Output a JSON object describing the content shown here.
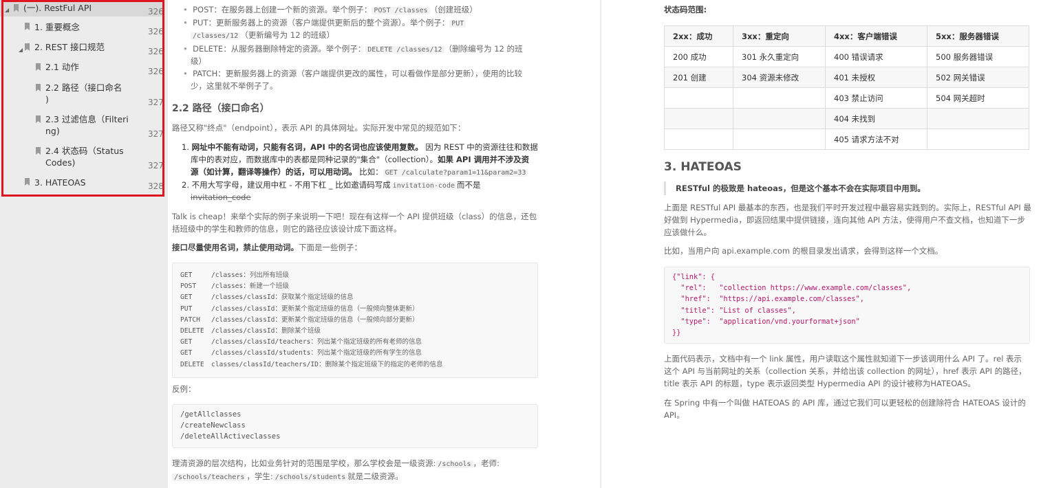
{
  "outline": {
    "items": [
      {
        "label": "(一). RestFul API",
        "page": "326",
        "collapse": "◢"
      },
      {
        "label": "1. 重要概念",
        "page": "326"
      },
      {
        "label": "2. REST 接口规范",
        "page": "326",
        "collapse": "◢"
      },
      {
        "label": "2.1 动作",
        "page": "326"
      },
      {
        "label": "2.2 路径（接口命名",
        "label2": ")",
        "page": "327"
      },
      {
        "label": "2.3 过滤信息（Filteri",
        "label2": "ng)",
        "page": "327"
      },
      {
        "label": "2.4 状态码（Status",
        "label2": "Codes)",
        "page": "327"
      },
      {
        "label": "3. HATEOAS",
        "page": "328"
      }
    ]
  },
  "left": {
    "bullets": {
      "post": {
        "verb": "POST：",
        "text": "在服务器上创建一个新的资源。举个例子：",
        "code": "POST /classes",
        "tail": "（创建班级）"
      },
      "put": {
        "verb": "PUT：",
        "text": "更新服务器上的资源（客户端提供更新后的整个资源）。举个例子：",
        "code1": "PUT",
        "code2": "/classes/12",
        "tail": "（更新编号为 12 的班级）"
      },
      "delete": {
        "verb": "DELETE：",
        "text": "从服务器删除特定的资源。举个例子：",
        "code": "DELETE /classes/12",
        "tail": "（删除编号为 12 的班",
        "tail2": "级）"
      },
      "patch": {
        "verb": "PATCH：",
        "text": "更新服务器上的资源（客户端提供更改的属性，可以看做作是部分更新），使用的比较",
        "text2": "少，这里就不举例子了。"
      }
    },
    "h_path": "2.2 路径（接口命名）",
    "path_intro": "路径又称\"终点\"（endpoint），表示 API 的具体网址。实际开发中常见的规范如下：",
    "rule1": {
      "num": "1.",
      "b1": "网址中不能有动词，只能有名词，API 中的名词也应该使用复数。",
      "t1": "因为 REST 中的资源往往和数据",
      "t2": "库中的表对应，而数据库中的表都是同种记录的\"集合\"（collection）。",
      "b2": "如果 API 调用并不涉及资",
      "b3": "源（如计算，翻译等操作）的话，可以用动词。",
      "t3": "比如：",
      "code": "GET /calculate?param1=11&param2=33"
    },
    "rule2": {
      "num": "2.",
      "t1": "不用大写字母，建议用中杠 - 不用下杠 _ 比如邀请码写成",
      "code": "invitation-code",
      "t2": "而不是",
      "strike": "invitation_code"
    },
    "talk": "Talk is cheap！来举个实际的例子来说明一下吧！现在有这样一个 API 提供班级（class）的信息，还包",
    "talk2": "括班级中的学生和教师的信息，则它的路径应该设计成下面这样。",
    "noun_bold": "接口尽量使用名词，禁止使用动词。",
    "noun_tail": "下面是一些例子：",
    "examples": [
      {
        "m": "GET",
        "p": "/classes：",
        "c": "列出所有班级"
      },
      {
        "m": "POST",
        "p": "/classes：",
        "c": "新建一个班级"
      },
      {
        "m": "GET",
        "p": "/classes/classId：",
        "c": "获取某个指定班级的信息"
      },
      {
        "m": "PUT",
        "p": "/classes/classId：",
        "c": "更新某个指定班级的信息（一般倾向整体更新）"
      },
      {
        "m": "PATCH",
        "p": "/classes/classId：",
        "c": "更新某个指定班级的信息（一般倾向部分更新）"
      },
      {
        "m": "DELETE",
        "p": "/classes/classId：",
        "c": "删除某个班级"
      },
      {
        "m": "GET",
        "p": "/classes/classId/teachers：",
        "c": "列出某个指定班级的所有老师的信息"
      },
      {
        "m": "GET",
        "p": "/classes/classId/students：",
        "c": "列出某个指定班级的所有学生的信息"
      },
      {
        "m": "DELETE",
        "p": "classes/classId/teachers/ID：",
        "c": "删除某个指定班级下的指定的老师的信息"
      }
    ],
    "counter": "反例：",
    "counter_lines": [
      "/getAllclasses",
      "/createNewclass",
      "/deleteAllActiveclasses"
    ],
    "hier1": "理清资源的层次结构，比如业务针对的范围是学校，那么学校会是一级资源:",
    "hier_code1": "/schools",
    "hier_t2": "，老师:",
    "hier_code2": "/schools/teachers",
    "hier_t3": "，学生:",
    "hier_code3": "/schools/students",
    "hier_t4": "就是二级资源。"
  },
  "right": {
    "status_title": "状态码范围:",
    "table": {
      "headers": [
        "2xx：成功",
        "3xx：重定向",
        "4xx：客户端错误",
        "5xx：服务器错误"
      ],
      "rows": [
        [
          "200 成功",
          "301 永久重定向",
          "400 错误请求",
          "500 服务器错误"
        ],
        [
          "201 创建",
          "304 资源未修改",
          "401 未授权",
          "502 网关错误"
        ],
        [
          "",
          "",
          "403 禁止访问",
          "504 网关超时"
        ],
        [
          "",
          "",
          "404 未找到",
          ""
        ],
        [
          "",
          "",
          "405 请求方法不对",
          ""
        ]
      ]
    },
    "h_hateoas": "3. HATEOAS",
    "quote": "RESTful 的极致是 hateoas，但是这个基本不会在实际项目中用到。",
    "p1a": "上面是 RESTful API 最基本的东西，也是我们平时开发过程中最容易实践到的。实际上，RESTful API 最",
    "p1b": "好做到 Hypermedia，即返回结果中提供链接，连向其他 API 方法，使得用户不查文档，也知道下一步",
    "p1c": "应该做什么。",
    "p2": "比如，当用户向 api.example.com 的根目录发出请求，会得到这样一个文档。",
    "json": [
      {
        "k": "{\"link\"",
        "v": ": {"
      },
      {
        "k": "  \"rel\"",
        "v": ":   \"collection https://www.example.com/classes\","
      },
      {
        "k": "  \"href\"",
        "v": ":  \"https://api.example.com/classes\","
      },
      {
        "k": "  \"title\"",
        "v": ": \"List of classes\","
      },
      {
        "k": "  \"type\"",
        "v": ":  \"application/vnd.yourformat+json\""
      },
      {
        "k": "}}",
        "v": ""
      }
    ],
    "p3a": "上面代码表示，文档中有一个 link 属性，用户读取这个属性就知道下一步该调用什么 API 了。rel 表示",
    "p3b": "这个 API 与当前网址的关系（collection 关系，并给出该 collection 的网址），href 表示 API 的路径，",
    "p3c": "title 表示 API 的标题，type 表示返回类型 Hypermedia API 的设计被称为HATEOAS。",
    "p4a": "在 Spring 中有一个叫做 HATEOAS 的 API 库，通过它我们可以更轻松的创建除符合 HATEOAS 设计的",
    "p4b": "API。"
  },
  "colors": {
    "highlight": "#e0141e",
    "sidebar": "#ececec"
  }
}
